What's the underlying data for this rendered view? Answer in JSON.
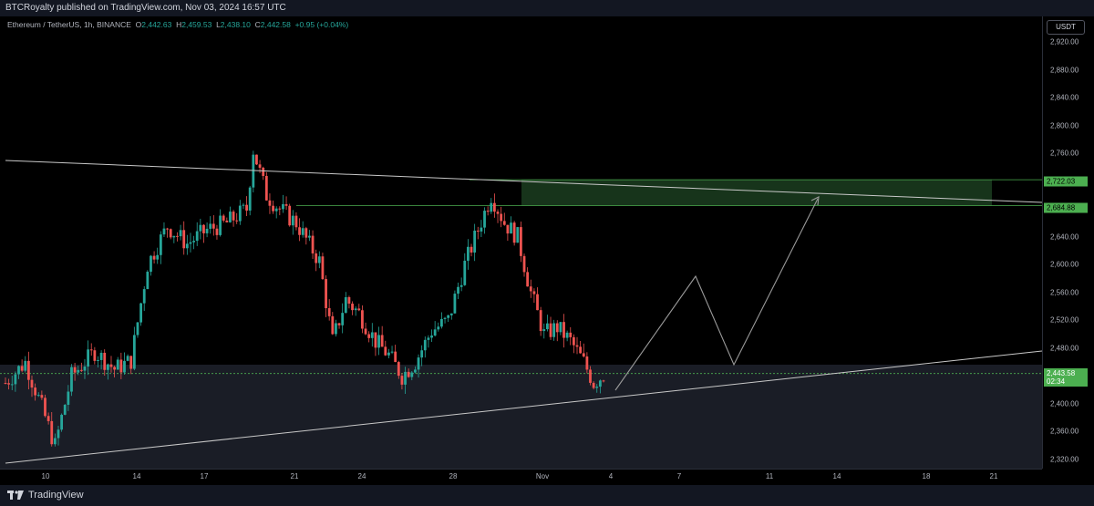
{
  "header": {
    "publisher": "BTCRoyalty published on TradingView.com, Nov 03, 2024 16:57 UTC"
  },
  "symbol": {
    "name": "Ethereum / TetherUS, 1h, BINANCE",
    "o_label": "O",
    "open": "2,442.63",
    "h_label": "H",
    "high": "2,459.53",
    "l_label": "L",
    "low": "2,438.10",
    "c_label": "C",
    "close": "2,442.58",
    "change": "+0.95 (+0.04%)"
  },
  "currency": "USDT",
  "price_axis": {
    "ticks": [
      "2,920.00",
      "2,880.00",
      "2,840.00",
      "2,800.00",
      "2,760.00",
      "2,720.00",
      "2,680.00",
      "2,640.00",
      "2,600.00",
      "2,560.00",
      "2,520.00",
      "2,480.00",
      "2,440.00",
      "2,400.00",
      "2,360.00",
      "2,320.00"
    ],
    "level_top": "2,722.03",
    "level_bottom": "2,684.88",
    "last_price": "2,443.58",
    "countdown": "02:34"
  },
  "time_axis": {
    "ticks": [
      "10",
      "14",
      "17",
      "21",
      "24",
      "28",
      "Nov",
      "4",
      "7",
      "11",
      "14",
      "18",
      "21"
    ]
  },
  "footer": {
    "brand": "TradingView"
  },
  "colors": {
    "up": "#26a69a",
    "down": "#ef5350",
    "zone": "#1b3a1f",
    "accent_green": "#4caf50",
    "bg": "#000000"
  },
  "chart_data": {
    "type": "candlestick",
    "title": "Ethereum / TetherUS, 1h, BINANCE",
    "y_range": [
      2300,
      2960
    ],
    "x_ticks": [
      "10",
      "14",
      "17",
      "21",
      "24",
      "28",
      "Nov",
      "4",
      "7",
      "11",
      "14",
      "18",
      "21"
    ],
    "path_closes": [
      [
        0,
        2430
      ],
      [
        6,
        2460
      ],
      [
        11,
        2395
      ],
      [
        15,
        2340
      ],
      [
        20,
        2440
      ],
      [
        27,
        2475
      ],
      [
        33,
        2450
      ],
      [
        38,
        2462
      ],
      [
        43,
        2600
      ],
      [
        49,
        2655
      ],
      [
        55,
        2630
      ],
      [
        61,
        2650
      ],
      [
        67,
        2660
      ],
      [
        73,
        2680
      ],
      [
        75,
        2765
      ],
      [
        79,
        2700
      ],
      [
        83,
        2680
      ],
      [
        88,
        2660
      ],
      [
        95,
        2605
      ],
      [
        99,
        2490
      ],
      [
        103,
        2550
      ],
      [
        107,
        2530
      ],
      [
        112,
        2490
      ],
      [
        116,
        2470
      ],
      [
        120,
        2440
      ],
      [
        124,
        2460
      ],
      [
        129,
        2505
      ],
      [
        134,
        2520
      ],
      [
        139,
        2600
      ],
      [
        143,
        2650
      ],
      [
        147,
        2700
      ],
      [
        151,
        2660
      ],
      [
        155,
        2640
      ],
      [
        159,
        2560
      ],
      [
        163,
        2500
      ],
      [
        167,
        2510
      ],
      [
        171,
        2490
      ],
      [
        175,
        2460
      ],
      [
        178,
        2430
      ],
      [
        181,
        2442
      ]
    ],
    "zone": {
      "top": 2722.03,
      "bottom": 2684.88
    },
    "last_price": 2443.58
  }
}
